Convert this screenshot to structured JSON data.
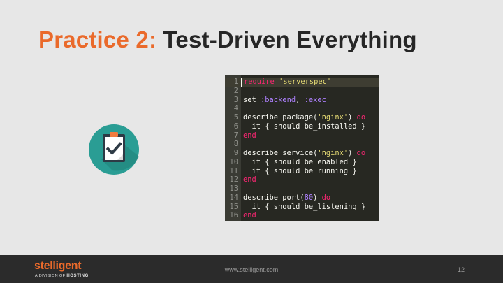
{
  "title": {
    "prefix": "Practice 2:",
    "main": "Test-Driven Everything"
  },
  "icon": {
    "name": "clipboard-check-icon",
    "circle_color": "#2a9d94"
  },
  "code": [
    {
      "n": "1",
      "t": [
        [
          "kw",
          "require"
        ],
        [
          "p",
          " "
        ],
        [
          "str",
          "'serverspec'"
        ]
      ]
    },
    {
      "n": "2",
      "t": []
    },
    {
      "n": "3",
      "t": [
        [
          "p",
          "set "
        ],
        [
          "sym",
          ":backend"
        ],
        [
          "p",
          ", "
        ],
        [
          "sym",
          ":exec"
        ]
      ]
    },
    {
      "n": "4",
      "t": []
    },
    {
      "n": "5",
      "t": [
        [
          "p",
          "describe package("
        ],
        [
          "str",
          "'nginx'"
        ],
        [
          "p",
          ") "
        ],
        [
          "kw",
          "do"
        ]
      ]
    },
    {
      "n": "6",
      "t": [
        [
          "p",
          "  it { should be_installed }"
        ]
      ]
    },
    {
      "n": "7",
      "t": [
        [
          "kw",
          "end"
        ]
      ]
    },
    {
      "n": "8",
      "t": []
    },
    {
      "n": "9",
      "t": [
        [
          "p",
          "describe service("
        ],
        [
          "str",
          "'nginx'"
        ],
        [
          "p",
          ") "
        ],
        [
          "kw",
          "do"
        ]
      ]
    },
    {
      "n": "10",
      "t": [
        [
          "p",
          "  it { should be_enabled }"
        ]
      ]
    },
    {
      "n": "11",
      "t": [
        [
          "p",
          "  it { should be_running }"
        ]
      ]
    },
    {
      "n": "12",
      "t": [
        [
          "kw",
          "end"
        ]
      ]
    },
    {
      "n": "13",
      "t": []
    },
    {
      "n": "14",
      "t": [
        [
          "p",
          "describe port("
        ],
        [
          "num",
          "80"
        ],
        [
          "p",
          ") "
        ],
        [
          "kw",
          "do"
        ]
      ]
    },
    {
      "n": "15",
      "t": [
        [
          "p",
          "  it { should be_listening }"
        ]
      ]
    },
    {
      "n": "16",
      "t": [
        [
          "kw",
          "end"
        ]
      ]
    }
  ],
  "footer": {
    "brand": "stelligent",
    "tagline_prefix": "A DIVISION OF ",
    "tagline_company": "HOSTING",
    "url": "www.stelligent.com",
    "page": "12"
  }
}
